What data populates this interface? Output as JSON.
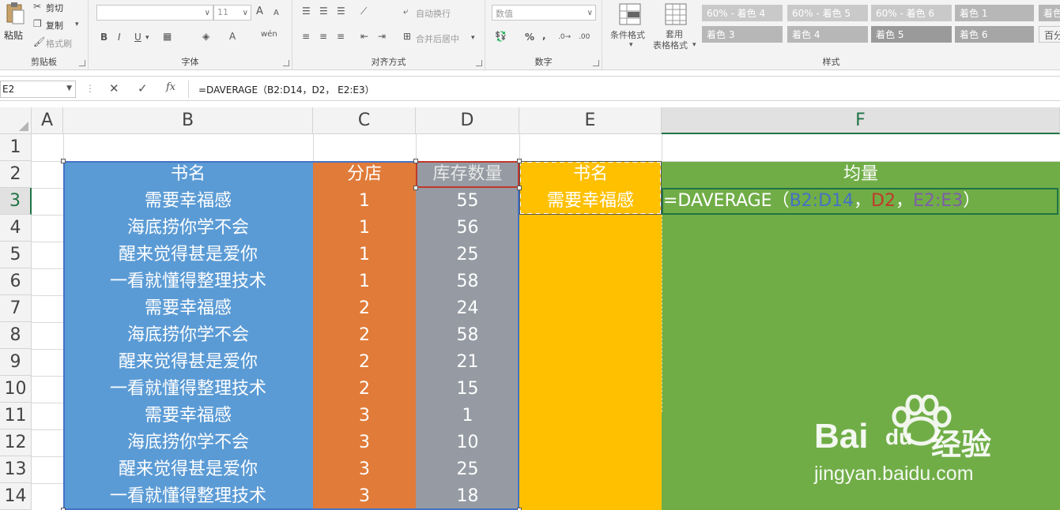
{
  "ribbon": {
    "clipboard": {
      "paste": "粘贴",
      "cut": "剪切",
      "copy": "复制",
      "format_painter": "格式刷",
      "title": "剪贴板"
    },
    "font": {
      "size": "11",
      "bold": "B",
      "italic": "I",
      "underline": "U",
      "grow": "A",
      "shrink": "A",
      "title": "字体"
    },
    "alignment": {
      "wrap_text": "自动换行",
      "merge_center": "合并后居中",
      "title": "对齐方式"
    },
    "number": {
      "format": "数值",
      "percent": "%",
      "comma": ",",
      "title": "数字"
    },
    "styles": {
      "conditional_format": "条件格式",
      "table_format_1": "套用",
      "table_format_2": "表格格式",
      "title": "样式",
      "cells": [
        {
          "label": "60% - 着色 4",
          "color": "#c9c9c9"
        },
        {
          "label": "60% - 着色 5",
          "color": "#c9c9c9"
        },
        {
          "label": "60% - 着色 6",
          "color": "#c9c9c9"
        },
        {
          "label": "着色 1",
          "color": "#b7b7b7"
        },
        {
          "label": "着色",
          "color": "#b7b7b7"
        },
        {
          "label": "着色 3",
          "color": "#b7b7b7"
        },
        {
          "label": "着色 4",
          "color": "#b7b7b7"
        },
        {
          "label": "着色 5",
          "color": "#9a9a9a"
        },
        {
          "label": "着色 6",
          "color": "#a6a6a6"
        },
        {
          "label": "百分",
          "color": "#f3f3f3"
        }
      ]
    }
  },
  "formula_bar": {
    "name_box": "E2",
    "cancel": "✕",
    "enter": "✓",
    "fx": "fx",
    "formula": "=DAVERAGE（B2:D14，D2， E2:E3）"
  },
  "sheet": {
    "columns": [
      "A",
      "B",
      "C",
      "D",
      "E",
      "F"
    ],
    "rows": [
      "1",
      "2",
      "3",
      "4",
      "5",
      "6",
      "7",
      "8",
      "9",
      "10",
      "11",
      "12",
      "13",
      "14"
    ],
    "headers": {
      "b": "书名",
      "c": "分店",
      "d": "库存数量",
      "e": "书名",
      "f": "均量"
    },
    "data": [
      {
        "book": "需要幸福感",
        "store": "1",
        "qty": "55"
      },
      {
        "book": "海底捞你学不会",
        "store": "1",
        "qty": "56"
      },
      {
        "book": "醒来觉得甚是爱你",
        "store": "1",
        "qty": "25"
      },
      {
        "book": "一看就懂得整理技术",
        "store": "1",
        "qty": "58"
      },
      {
        "book": "需要幸福感",
        "store": "2",
        "qty": "24"
      },
      {
        "book": "海底捞你学不会",
        "store": "2",
        "qty": "58"
      },
      {
        "book": "醒来觉得甚是爱你",
        "store": "2",
        "qty": "21"
      },
      {
        "book": "一看就懂得整理技术",
        "store": "2",
        "qty": "15"
      },
      {
        "book": "需要幸福感",
        "store": "3",
        "qty": "1"
      },
      {
        "book": "海底捞你学不会",
        "store": "3",
        "qty": "10"
      },
      {
        "book": "醒来觉得甚是爱你",
        "store": "3",
        "qty": "25"
      },
      {
        "book": "一看就懂得整理技术",
        "store": "3",
        "qty": "18"
      }
    ],
    "criteria_value": "需要幸福感",
    "editing_formula": {
      "prefix": "=DAVERAGE（",
      "ref1": "B2:D14",
      "sep1": "，",
      "ref2": "D2",
      "sep2": "，",
      "ref3": "E2:E3",
      "suffix": "）"
    },
    "colors": {
      "col_b": "#5b9bd5",
      "col_c": "#e07b39",
      "col_d": "#969ba3",
      "col_e": "#ffc000",
      "col_f": "#70ad47",
      "ref1": "#4472c4",
      "ref2": "#c0392b",
      "ref3": "#7d5fa8"
    }
  },
  "watermark": {
    "brand": "Bai",
    "brand2": "du",
    "product": "经验",
    "url": "jingyan.baidu.com"
  }
}
